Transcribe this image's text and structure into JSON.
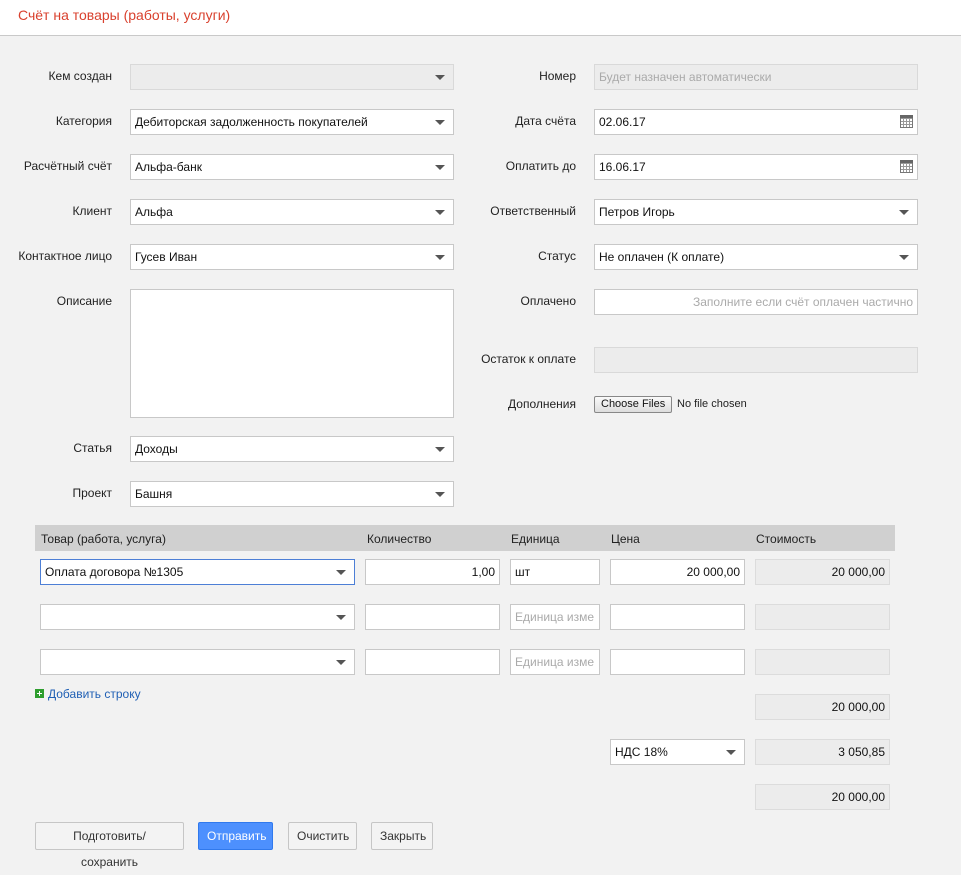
{
  "header": {
    "title": "Счёт на товары (работы, услуги)"
  },
  "left": {
    "created_by": {
      "label": "Кем создан",
      "value": ""
    },
    "category": {
      "label": "Категория",
      "value": "Дебиторская задолженность покупателей"
    },
    "account": {
      "label": "Расчётный счёт",
      "value": "Альфа-банк"
    },
    "client": {
      "label": "Клиент",
      "value": "Альфа"
    },
    "contact": {
      "label": "Контактное лицо",
      "value": "Гусев Иван"
    },
    "description": {
      "label": "Описание",
      "value": ""
    },
    "article": {
      "label": "Статья",
      "value": "Доходы"
    },
    "project": {
      "label": "Проект",
      "value": "Башня"
    }
  },
  "right": {
    "number": {
      "label": "Номер",
      "placeholder": "Будет назначен автоматически"
    },
    "invoice_date": {
      "label": "Дата счёта",
      "value": "02.06.17"
    },
    "pay_until": {
      "label": "Оплатить до",
      "value": "16.06.17"
    },
    "responsible": {
      "label": "Ответственный",
      "value": "Петров Игорь"
    },
    "status": {
      "label": "Статус",
      "value": "Не оплачен (К оплате)"
    },
    "paid": {
      "label": "Оплачено",
      "placeholder": "Заполните если счёт оплачен частично"
    },
    "remaining": {
      "label": "Остаток к оплате",
      "value": ""
    },
    "attachments": {
      "label": "Дополнения",
      "button": "Choose Files",
      "status": "No file chosen"
    }
  },
  "table": {
    "headers": [
      "Товар (работа, услуга)",
      "Количество",
      "Единица",
      "Цена",
      "Стоимость"
    ],
    "unit_placeholder": "Единица изме",
    "rows": [
      {
        "product": "Оплата договора №1305",
        "qty": "1,00",
        "unit": "шт",
        "price": "20 000,00",
        "cost": "20 000,00"
      },
      {
        "product": "",
        "qty": "",
        "unit": "",
        "price": "",
        "cost": ""
      },
      {
        "product": "",
        "qty": "",
        "unit": "",
        "price": "",
        "cost": ""
      }
    ],
    "add_row": "Добавить строку",
    "subtotal": "20 000,00",
    "vat_option": "НДС 18%",
    "vat_amount": "3 050,85",
    "total": "20 000,00"
  },
  "buttons": {
    "save": "Подготовить/ сохранить",
    "send": "Отправить",
    "clear": "Очистить",
    "close": "Закрыть"
  },
  "colors": {
    "title": "#d9412e",
    "primary": "#4d90fe",
    "link": "#1f5fb4"
  }
}
